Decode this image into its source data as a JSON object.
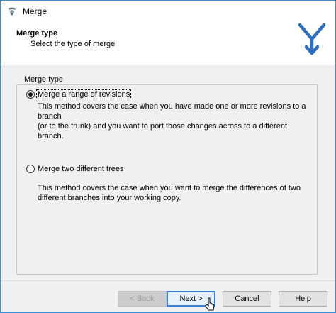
{
  "window": {
    "title": "Merge"
  },
  "header": {
    "title": "Merge type",
    "subtitle": "Select the type of merge"
  },
  "group": {
    "legend": "Merge type"
  },
  "options": [
    {
      "label": "Merge a range of revisions",
      "checked": true,
      "description_lines": [
        "This method covers the case when you have made one or more revisions to a branch",
        "(or to the trunk) and you want to port those changes across to a different branch."
      ]
    },
    {
      "label": "Merge two different trees",
      "checked": false,
      "description_lines": [
        "This method covers the case when you want to merge the differences of two",
        "different branches into your working copy."
      ]
    }
  ],
  "buttons": {
    "back": "< Back",
    "next": "Next >",
    "cancel": "Cancel",
    "help": "Help"
  },
  "colors": {
    "accent": "#3c7fd8",
    "logo": "#2e6fc0"
  },
  "icons": {
    "title": "merge-app-icon",
    "logo": "merge-logo-icon",
    "cursor": "mouse-pointer-icon"
  }
}
